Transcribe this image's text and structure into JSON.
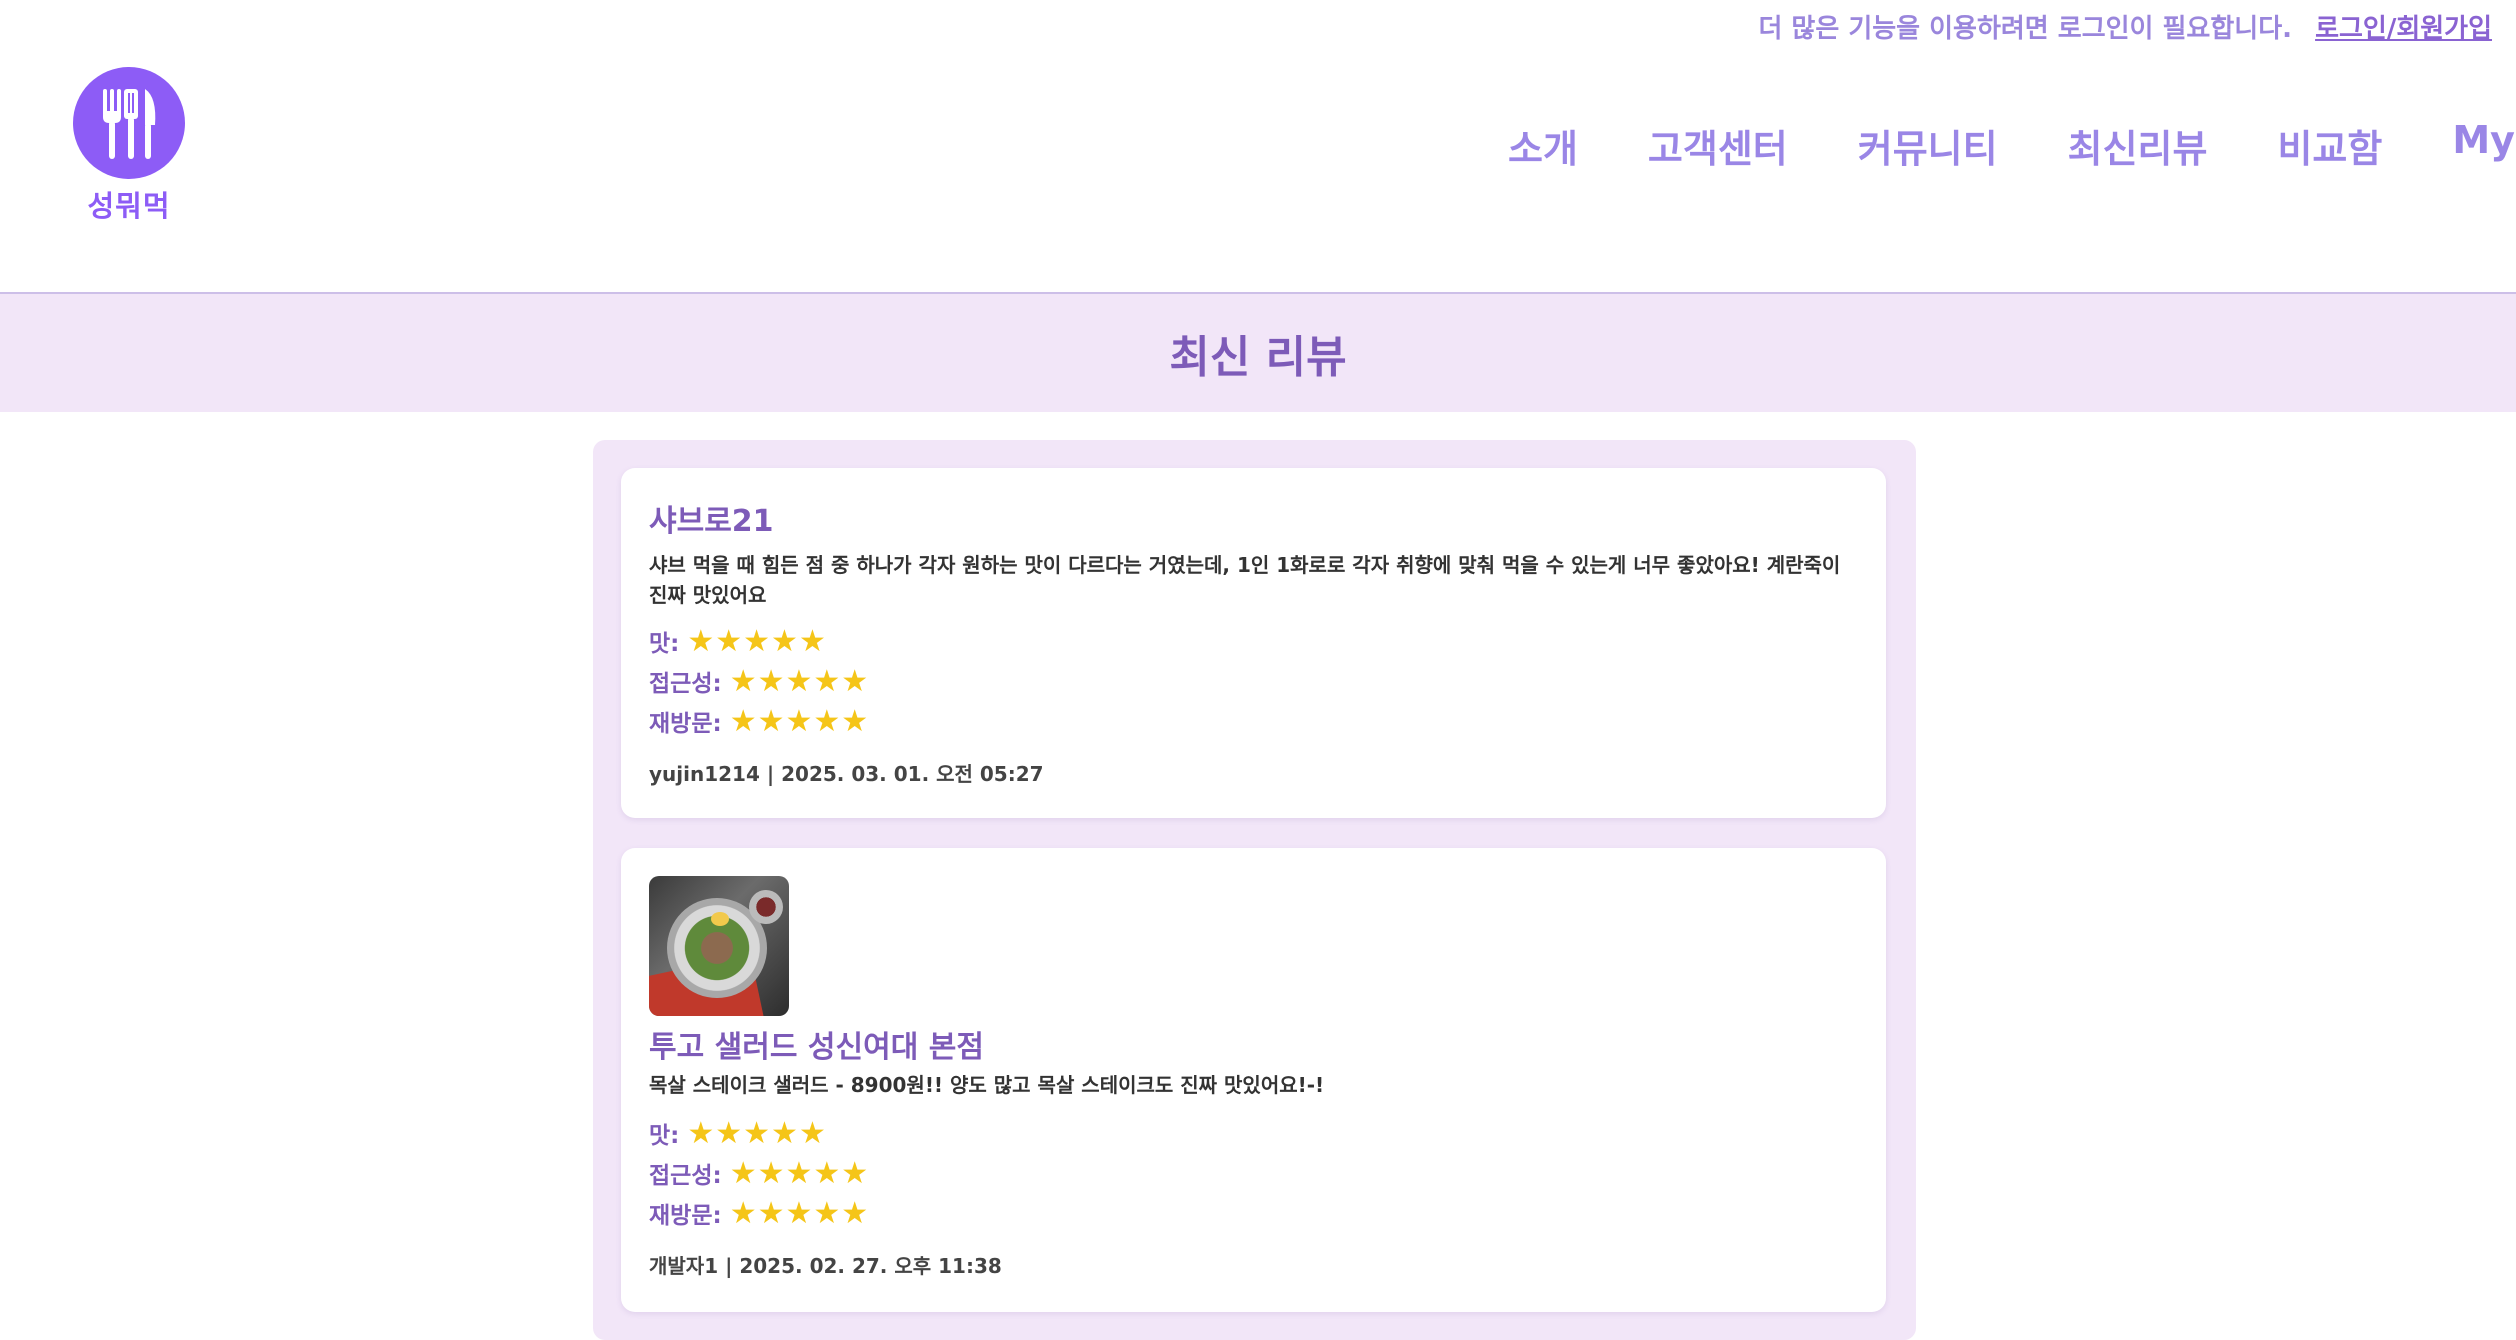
{
  "top_bar": {
    "message": "더 많은 기능을 이용하려면 로그인이 필요합니다.",
    "login_link": "로그인/회원가입"
  },
  "logo": {
    "text": "성뭐먹",
    "icon": "utensils-icon",
    "color": "#8d5cf6"
  },
  "nav": {
    "items": [
      "소개",
      "고객센터",
      "커뮤니티",
      "최신리뷰",
      "비교함",
      "My"
    ]
  },
  "page": {
    "title": "최신 리뷰"
  },
  "colors": {
    "accent": "#7d5bb8",
    "banner_bg": "#f2e6f8",
    "star": "#f5c518"
  },
  "reviews": [
    {
      "store_name": "샤브로21",
      "content": "샤브 먹을 때 힘든 점 중 하나가 각자 원하는 맛이 다르다는 거였는데, 1인 1화로로 각자 취향에 맞춰 먹을 수 있는게 너무 좋았아요! 계란죽이 진짜 맛있어요",
      "ratings": [
        {
          "label": "맛:",
          "stars": "★★★★★",
          "score": 5
        },
        {
          "label": "접근성:",
          "stars": "★★★★★",
          "score": 5
        },
        {
          "label": "재방문:",
          "stars": "★★★★★",
          "score": 5
        }
      ],
      "meta": "yujin1214 | 2025. 03. 01. 오전 05:27"
    },
    {
      "store_name": "투고 샐러드 성신여대 본점",
      "image": "salad-photo",
      "content": "목살 스테이크 샐러드 - 8900원!! 양도 많고 목살 스테이크도 진짜 맛있어요!-!",
      "ratings": [
        {
          "label": "맛:",
          "stars": "★★★★★",
          "score": 5
        },
        {
          "label": "접근성:",
          "stars": "★★★★★",
          "score": 5
        },
        {
          "label": "재방문:",
          "stars": "★★★★★",
          "score": 5
        }
      ],
      "meta": "개발자1 | 2025. 02. 27. 오후 11:38"
    }
  ]
}
